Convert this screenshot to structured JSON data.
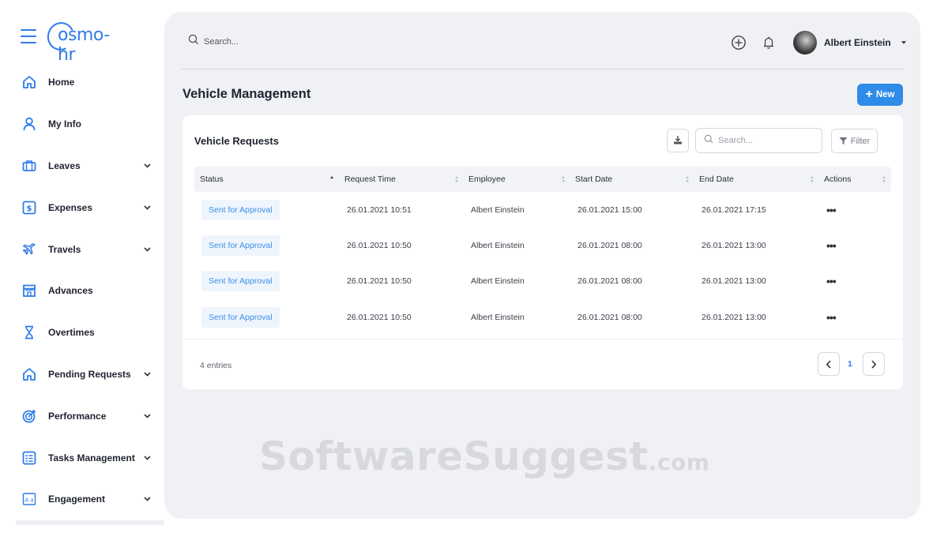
{
  "brand": {
    "logo_text": "osmo-hr",
    "accent": "#2f7ce8"
  },
  "sidebar": {
    "items": [
      {
        "label": "Home",
        "icon": "home-icon",
        "has_submenu": false
      },
      {
        "label": "My Info",
        "icon": "user-icon",
        "has_submenu": false
      },
      {
        "label": "Leaves",
        "icon": "briefcase-icon",
        "has_submenu": true
      },
      {
        "label": "Expenses",
        "icon": "dollar-icon",
        "has_submenu": true
      },
      {
        "label": "Travels",
        "icon": "airplane-icon",
        "has_submenu": true
      },
      {
        "label": "Advances",
        "icon": "store-icon",
        "has_submenu": false
      },
      {
        "label": "Overtimes",
        "icon": "hourglass-icon",
        "has_submenu": false
      },
      {
        "label": "Pending Requests",
        "icon": "home-icon",
        "has_submenu": true
      },
      {
        "label": "Performance",
        "icon": "target-icon",
        "has_submenu": true
      },
      {
        "label": "Tasks Management",
        "icon": "checklist-icon",
        "has_submenu": true
      },
      {
        "label": "Engagement",
        "icon": "engagement-icon",
        "has_submenu": true
      }
    ]
  },
  "header": {
    "search_placeholder": "Search...",
    "user_name": "Albert Einstein"
  },
  "page": {
    "title": "Vehicle Management",
    "new_button": "New"
  },
  "card": {
    "title": "Vehicle Requests",
    "search_placeholder": "Search...",
    "filter_label": "Filter",
    "columns": [
      "Status",
      "Request Time",
      "Employee",
      "Start Date",
      "End Date",
      "Actions"
    ],
    "rows": [
      {
        "status": "Sent for Approval",
        "request_time": "26.01.2021 10:51",
        "employee": "Albert Einstein",
        "start_date": "26.01.2021 15:00",
        "end_date": "26.01.2021 17:15",
        "actions": "•••"
      },
      {
        "status": "Sent for Approval",
        "request_time": "26.01.2021 10:50",
        "employee": "Albert Einstein",
        "start_date": "26.01.2021 08:00",
        "end_date": "26.01.2021 13:00",
        "actions": "•••"
      },
      {
        "status": "Sent for Approval",
        "request_time": "26.01.2021 10:50",
        "employee": "Albert Einstein",
        "start_date": "26.01.2021 08:00",
        "end_date": "26.01.2021 13:00",
        "actions": "•••"
      },
      {
        "status": "Sent for Approval",
        "request_time": "26.01.2021 10:50",
        "employee": "Albert Einstein",
        "start_date": "26.01.2021 08:00",
        "end_date": "26.01.2021 13:00",
        "actions": "•••"
      }
    ],
    "entries_text": "4 entries",
    "current_page": "1"
  },
  "watermark": {
    "main": "SoftwareSuggest",
    "suffix": ".com"
  }
}
